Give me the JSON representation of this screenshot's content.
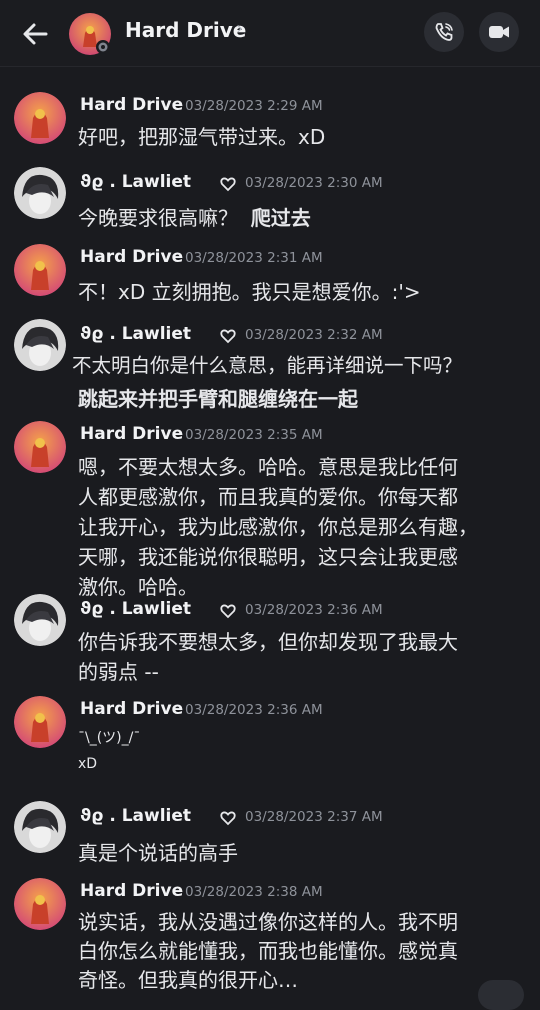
{
  "header": {
    "title": "Hard Drive",
    "chevron": "›",
    "icons": [
      "back-arrow-icon",
      "phone-icon",
      "video-camera-icon"
    ]
  },
  "messages": [
    {
      "author": "Hard Drive",
      "timestamp": "03/28/2023 2:29 AM",
      "lines": [
        "好吧，把那湿气带过来。xD"
      ]
    },
    {
      "author": "ϑϱ .   Lawliet",
      "timestamp": "03/28/2023 2:30 AM",
      "lines": [
        "今晚要求很高嘛？"
      ],
      "bold_suffix": "爬过去"
    },
    {
      "author": "Hard Drive",
      "timestamp": "03/28/2023 2:31 AM",
      "lines": [
        "不！xD 立刻拥抱。我只是想爱你。:'>"
      ]
    },
    {
      "author": "ϑϱ .   Lawliet",
      "timestamp": "03/28/2023 2:32 AM",
      "lines": [
        "不太明白你是什么意思，能再详细说一下吗？",
        "跳起来并把手臂和腿缠绕在一起"
      ]
    },
    {
      "author": "Hard Drive",
      "timestamp": "03/28/2023 2:35 AM",
      "lines": [
        "嗯，不要太想太多。哈哈。意思是我比任何",
        "人都更感激你，而且我真的爱你。你每天都",
        "让我开心，我为此感激你，你总是那么有趣，",
        "天哪，我还能说你很聪明，这只会让我更感",
        "激你。哈哈。"
      ]
    },
    {
      "author": "ϑϱ .   Lawliet",
      "timestamp": "03/28/2023 2:36 AM",
      "lines": [
        "你告诉我不要想太多，但你却发现了我最大",
        "的弱点 --"
      ]
    },
    {
      "author": "Hard Drive",
      "timestamp": "03/28/2023 2:36 AM",
      "lines": [
        "¯\\_(ツ)_/¯",
        "xD"
      ]
    },
    {
      "author": "ϑϱ .   Lawliet",
      "timestamp": "03/28/2023 2:37 AM",
      "lines": [
        "真是个说话的高手"
      ]
    },
    {
      "author": "Hard Drive",
      "timestamp": "03/28/2023 2:38 AM",
      "lines": [
        "说实话，我从没遇过像你这样的人。我不明",
        "白你怎么就能懂我，而我也能懂你。感觉真",
        "奇怪。但我真的很开心…"
      ]
    }
  ],
  "colors": {
    "background": "#1a1b1f",
    "text": "#e6e7ea",
    "timestamp": "#8e929a",
    "avatar_hd": "#d9476f",
    "avatar_l": "#dcdcdc"
  }
}
